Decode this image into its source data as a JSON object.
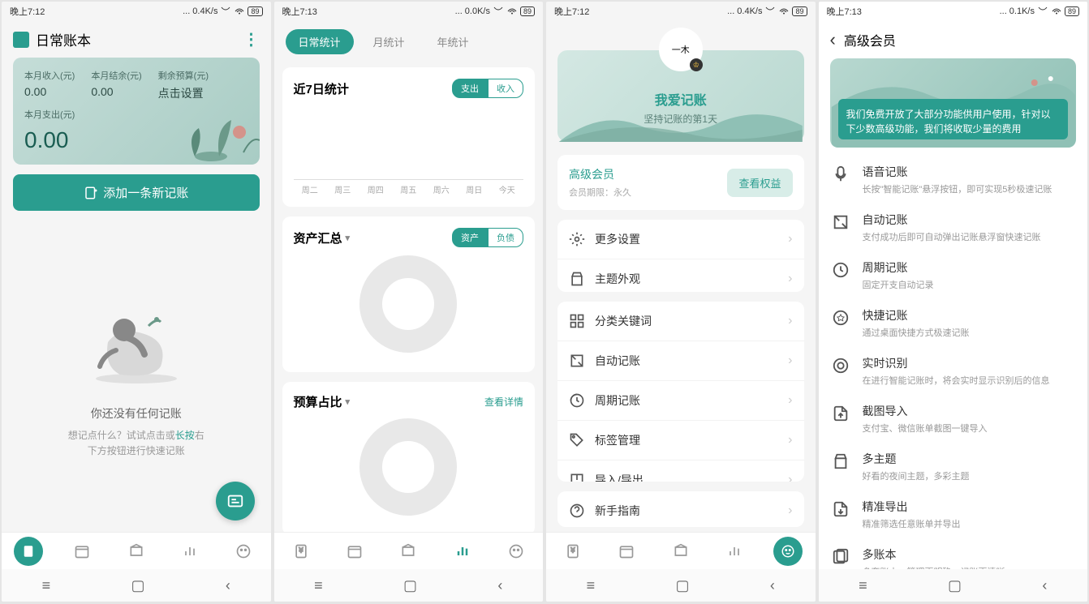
{
  "status": {
    "s1": {
      "time": "晚上7:12",
      "net": "0.4K/s",
      "batt": "89"
    },
    "s2": {
      "time": "晚上7:13",
      "net": "0.0K/s",
      "batt": "89"
    },
    "s3": {
      "time": "晚上7:12",
      "net": "0.4K/s",
      "batt": "89"
    },
    "s4": {
      "time": "晚上7:13",
      "net": "0.1K/s",
      "batt": "89"
    }
  },
  "screen1": {
    "title": "日常账本",
    "income_label": "本月收入(元)",
    "income": "0.00",
    "balance_label": "本月结余(元)",
    "balance": "0.00",
    "budget_label": "剩余预算(元)",
    "budget_value": "点击设置",
    "expense_label": "本月支出(元)",
    "expense": "0.00",
    "add_btn": "添加一条新记账",
    "empty_title": "你还没有任何记账",
    "empty_line1": "想记点什么？试试点击或",
    "empty_longpress": "长按",
    "empty_line1_end": "右",
    "empty_line2": "下方按钮进行快速记账"
  },
  "screen2": {
    "tab1": "日常统计",
    "tab2": "月统计",
    "tab3": "年统计",
    "card1_title": "近7日统计",
    "pill_expense": "支出",
    "pill_income": "收入",
    "axis": [
      "周二",
      "周三",
      "周四",
      "周五",
      "周六",
      "周日",
      "今天"
    ],
    "card2_title": "资产汇总",
    "pill_asset": "资产",
    "pill_debt": "负债",
    "card3_title": "预算占比",
    "view_detail": "查看详情"
  },
  "screen3": {
    "avatar_text": "一木",
    "name": "我爱记账",
    "sub": "坚持记账的第1天",
    "vip_title": "高级会员",
    "vip_sub_label": "会员期限：",
    "vip_sub_value": "永久",
    "vip_btn": "查看权益",
    "menu1": [
      "更多设置",
      "主题外观"
    ],
    "menu2": [
      "分类关键词",
      "自动记账",
      "周期记账",
      "标签管理",
      "导入/导出"
    ],
    "menu3": [
      "新手指南"
    ]
  },
  "screen4": {
    "title": "高级会员",
    "notice": "我们免费开放了大部分功能供用户使用，针对以下少数高级功能，我们将收取少量的费用",
    "features": [
      {
        "name": "语音记账",
        "desc": "长按\"智能记账\"悬浮按钮，即可实现5秒极速记账"
      },
      {
        "name": "自动记账",
        "desc": "支付成功后即可自动弹出记账悬浮窗快速记账"
      },
      {
        "name": "周期记账",
        "desc": "固定开支自动记录"
      },
      {
        "name": "快捷记账",
        "desc": "通过桌面快捷方式极速记账"
      },
      {
        "name": "实时识别",
        "desc": "在进行智能记账时，将会实时显示识别后的信息"
      },
      {
        "name": "截图导入",
        "desc": "支付宝、微信账单截图一键导入"
      },
      {
        "name": "多主题",
        "desc": "好看的夜间主题，多彩主题"
      },
      {
        "name": "精准导出",
        "desc": "精准筛选任意账单并导出"
      },
      {
        "name": "多账本",
        "desc": "多套账本，管理更明确，记账更清晰"
      }
    ]
  }
}
